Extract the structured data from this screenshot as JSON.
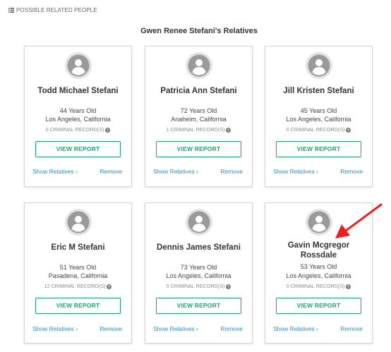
{
  "section": {
    "header_label": "POSSIBLE RELATED PEOPLE",
    "title": "Gwen Renee Stefani's Relatives"
  },
  "cards": [
    {
      "name_line1": "Todd Michael Stefani",
      "name_line2": "",
      "age": "44 Years Old",
      "location": "Los Angeles, California",
      "records": "0 CRIMINAL RECORD(S)"
    },
    {
      "name_line1": "Patricia Ann Stefani",
      "name_line2": "",
      "age": "72 Years Old",
      "location": "Anaheim, California",
      "records": "1 CRIMINAL RECORD(S)"
    },
    {
      "name_line1": "Jill Kristen Stefani",
      "name_line2": "",
      "age": "45 Years Old",
      "location": "Los Angeles, California",
      "records": "0 CRIMINAL RECORD(S)"
    },
    {
      "name_line1": "Eric M Stefani",
      "name_line2": "",
      "age": "51 Years Old",
      "location": "Pasadena, California",
      "records": "12 CRIMINAL RECORD(S)"
    },
    {
      "name_line1": "Dennis James Stefani",
      "name_line2": "",
      "age": "73 Years Old",
      "location": "Los Angeles, California",
      "records": "5 CRIMINAL RECORD(S)"
    },
    {
      "name_line1": "Gavin Mcgregor",
      "name_line2": "Rossdale",
      "age": "53 Years Old",
      "location": "Los Angeles, California",
      "records": "0 CRIMINAL RECORD(S)"
    }
  ],
  "actions": {
    "view_report": "VIEW REPORT",
    "show_relatives": "Show Relatives ›",
    "remove": "Remove"
  },
  "colors": {
    "accent_green": "#1aa56f",
    "link_blue": "#2b8ecd",
    "annotation_arrow": "#e8201e"
  },
  "icons": {
    "header": "list-icon",
    "avatar": "user-avatar-icon",
    "records_help": "help-circle-icon",
    "annotation": "red-arrow-annotation"
  }
}
